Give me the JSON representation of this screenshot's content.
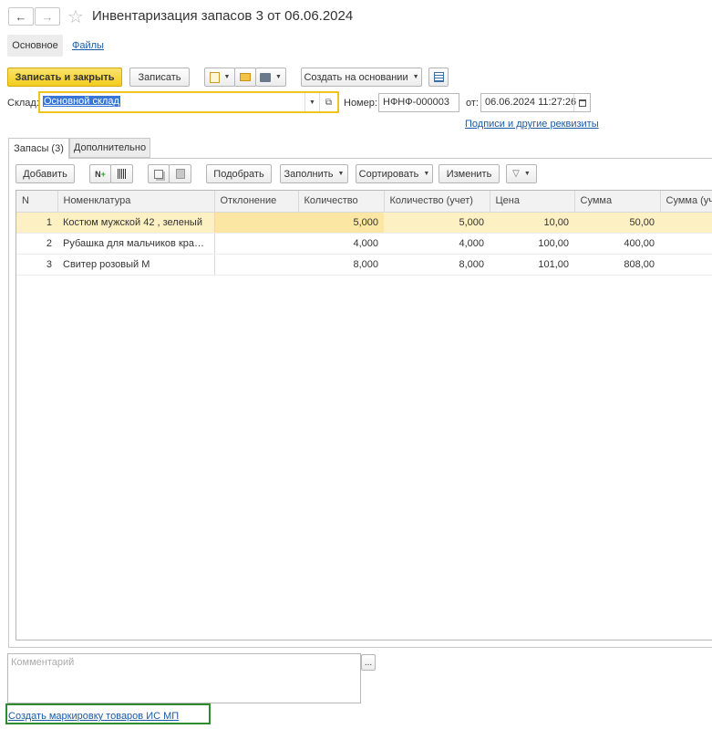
{
  "window": {
    "title": "Инвентаризация запасов 3 от 06.06.2024"
  },
  "nav_tabs": [
    {
      "label": "Основное"
    },
    {
      "label": "Файлы"
    }
  ],
  "toolbar": {
    "save_close_label": "Записать и закрыть",
    "save_label": "Записать",
    "create_basis_label": "Создать на основании"
  },
  "form": {
    "warehouse_label": "Склад:",
    "warehouse_value": "Основной склад",
    "number_label": "Номер:",
    "number_value": "НФНФ-000003",
    "date_label": "от:",
    "date_value": "06.06.2024 11:27:26",
    "signatures_link": "Подписи и другие реквизиты"
  },
  "tabs": [
    {
      "label": "Запасы (3)"
    },
    {
      "label": "Дополнительно"
    }
  ],
  "table_toolbar": {
    "add_label": "Добавить",
    "pick_label": "Подобрать",
    "fill_label": "Заполнить",
    "sort_label": "Сортировать",
    "change_label": "Изменить"
  },
  "table": {
    "columns": [
      "N",
      "Номенклатура",
      "Отклонение",
      "Количество",
      "Количество (учет)",
      "Цена",
      "Сумма",
      "Сумма (уч"
    ],
    "rows": [
      {
        "n": "1",
        "name": "Костюм мужской 42 , зеленый",
        "deviation": "",
        "qty": "5,000",
        "qty_acc": "5,000",
        "price": "10,00",
        "sum": "50,00",
        "sum_acc": ""
      },
      {
        "n": "2",
        "name": "Рубашка для мальчиков красн...",
        "deviation": "",
        "qty": "4,000",
        "qty_acc": "4,000",
        "price": "100,00",
        "sum": "400,00",
        "sum_acc": ""
      },
      {
        "n": "3",
        "name": "Свитер розовый М",
        "deviation": "",
        "qty": "8,000",
        "qty_acc": "8,000",
        "price": "101,00",
        "sum": "808,00",
        "sum_acc": ""
      }
    ]
  },
  "comment": {
    "placeholder": "Комментарий",
    "select_button": "..."
  },
  "footer": {
    "marking_link": "Создать маркировку товаров ИС МП"
  },
  "colors": {
    "primary_button": "#f5d633",
    "selected_row": "#fdf0c2",
    "link": "#1c5aa6",
    "focus_border": "#f0c419",
    "highlight_frame": "#2e8b2e"
  }
}
